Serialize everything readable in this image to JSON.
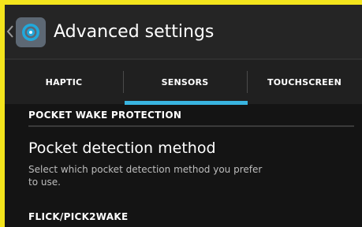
{
  "action_bar": {
    "title": "Advanced settings",
    "up_icon": "chevron-left-icon",
    "app_icon": "settings-gear-icon"
  },
  "tabs": [
    {
      "label": "HAPTIC",
      "selected": false
    },
    {
      "label": "SENSORS",
      "selected": true
    },
    {
      "label": "TOUCHSCREEN",
      "selected": false
    }
  ],
  "content": {
    "section1_header": "POCKET WAKE PROTECTION",
    "preference": {
      "title": "Pocket detection method",
      "summary": "Select which pocket detection method you prefer to use."
    },
    "section2_header": "FLICK/PICK2WAKE"
  },
  "colors": {
    "frame": "#f3e41c",
    "background": "#141414",
    "action_bar": "#252525",
    "tab_bar": "#202020",
    "accent": "#39b4e0",
    "summary_text": "#bdbdbd"
  }
}
